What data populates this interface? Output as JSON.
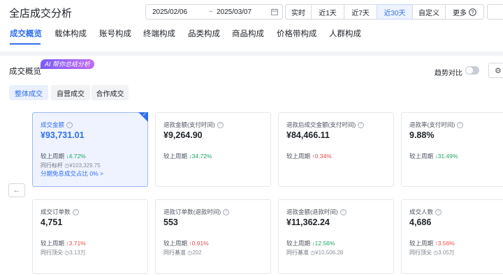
{
  "header": {
    "title": "全店成交分析",
    "date_start": "2025/02/06",
    "date_sep": "–",
    "date_end": "2025/03/07",
    "periods": [
      "实时",
      "近1天",
      "近7天",
      "近30天",
      "自定义",
      "更多"
    ],
    "active_period": "近30天"
  },
  "tabs": [
    "成交概览",
    "载体构成",
    "账号构成",
    "终端构成",
    "品类构成",
    "商品构成",
    "价格带构成",
    "人群构成"
  ],
  "overview": {
    "title": "成交概览",
    "ai_badge": "AI 帮你总结分析",
    "trend_label": "趋势对比",
    "segments": [
      "整体成交",
      "自营成交",
      "合作成交"
    ]
  },
  "cards": [
    {
      "label": "成交金额",
      "value": "¥93,731.01",
      "cmp_label": "较上周期",
      "cmp_dir": "↓",
      "cmp_value": "4.72%",
      "peer_label": "同行标杆",
      "peer_value": "¥103,329.75",
      "extra": "分期免息成交占比 0% >"
    },
    {
      "label": "退款金额(支付时间)",
      "value": "¥9,264.90",
      "cmp_label": "较上周期",
      "cmp_dir": "↓",
      "cmp_value": "34.72%"
    },
    {
      "label": "退款后成交金额(支付时间)",
      "value": "¥84,466.11",
      "cmp_label": "较上周期",
      "cmp_dir": "↑",
      "cmp_value": "0.34%"
    },
    {
      "label": "退款率(支付时间)",
      "value": "9.88%",
      "cmp_label": "较上周期",
      "cmp_dir": "↓",
      "cmp_value": "31.49%"
    },
    {
      "label": "成交订单数",
      "value": "4,751",
      "cmp_label": "较上周期",
      "cmp_dir": "↑",
      "cmp_value": "3.71%",
      "peer_label": "同行顶尖",
      "peer_value": "3.13万"
    },
    {
      "label": "退款订单数(退款时间)",
      "value": "553",
      "cmp_label": "较上周期",
      "cmp_dir": "↑",
      "cmp_value": "0.91%",
      "peer_label": "同行基准",
      "peer_value": "202"
    },
    {
      "label": "退款金额(退款时间)",
      "value": "¥11,362.24",
      "cmp_label": "较上周期",
      "cmp_dir": "↓",
      "cmp_value": "12.56%",
      "peer_label": "同行基准",
      "peer_value": "¥10,506.28"
    },
    {
      "label": "成交人数",
      "value": "4,686",
      "cmp_label": "较上周期",
      "cmp_dir": "↑",
      "cmp_value": "3.56%",
      "peer_label": "同行顶尖",
      "peer_value": "3.05万"
    }
  ]
}
